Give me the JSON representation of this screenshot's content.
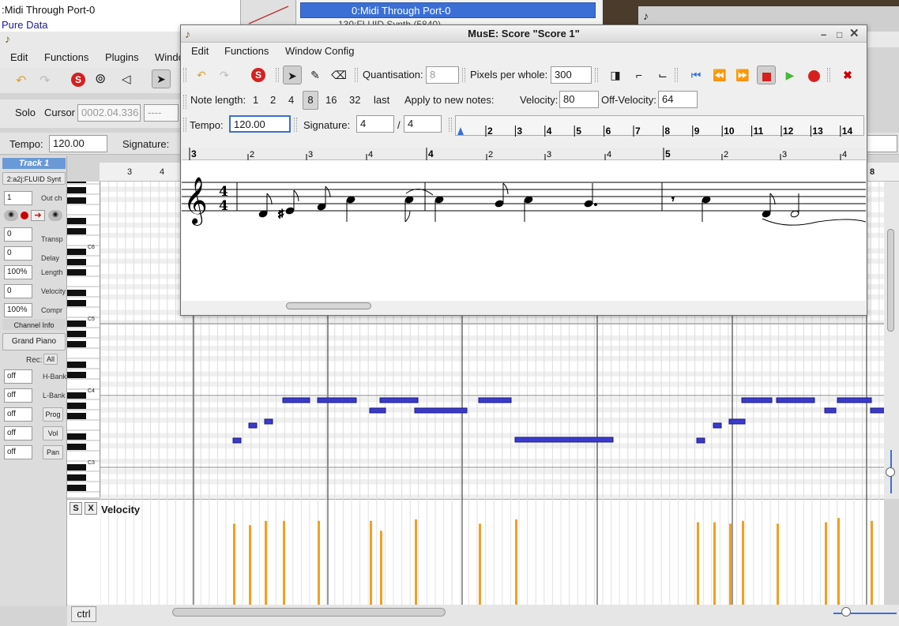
{
  "background": {
    "win1_line1": ":Midi Through Port-0",
    "win1_line2": "Pure Data",
    "win3_selected": "0:Midi Through Port-0",
    "win3_sub": "130:FLUID Synth (5840)"
  },
  "main": {
    "menu": [
      "Edit",
      "Functions",
      "Plugins",
      "Windo"
    ],
    "solo_label": "Solo",
    "cursor_label": "Cursor",
    "cursor_value": "0002.04.336",
    "cursor_extra": "----",
    "tempo_label": "Tempo:",
    "tempo_value": "120.00",
    "signature_label": "Signature:"
  },
  "track_panel": {
    "title": "Track 1",
    "port": "2:a2j:FLUID Synt",
    "out_ch_value": "1",
    "out_ch_label": "Out ch",
    "transp_value": "0",
    "transp_label": "Transp",
    "delay_value": "0",
    "delay_label": "Delay",
    "length_value": "100%",
    "length_label": "Length",
    "velocity_value": "0",
    "velocity_label": "Velocity",
    "compr_value": "100%",
    "compr_label": "Compr",
    "channel_info": "Channel Info",
    "instrument": "Grand Piano",
    "rec_label": "Rec:",
    "rec_all": "All",
    "hbank_value": "off",
    "hbank_label": "H-Bank",
    "lbank_value": "off",
    "lbank_label": "L-Bank",
    "prog_value": "off",
    "prog_label": "Prog",
    "vol_value": "off",
    "vol_label": "Vol",
    "pan_value": "off",
    "pan_label": "Pan"
  },
  "pianoroll": {
    "ruler_labels": [
      "3",
      "4",
      "8"
    ],
    "octave_labels": [
      "C6",
      "C5",
      "C4",
      "C3"
    ],
    "velocity_s": "S",
    "velocity_x": "X",
    "velocity_label": "Velocity",
    "ctrl_button": "ctrl"
  },
  "score": {
    "title": "MusE: Score \"Score 1\"",
    "menu": [
      "Edit",
      "Functions",
      "Window Config"
    ],
    "quantisation_label": "Quantisation:",
    "quantisation_value": "8",
    "pixels_label": "Pixels per whole:",
    "pixels_value": "300",
    "note_length_label": "Note length:",
    "note_lengths": [
      "1",
      "2",
      "4",
      "8",
      "16",
      "32",
      "last"
    ],
    "note_length_selected": "8",
    "apply_label": "Apply to new notes:",
    "velocity_label": "Velocity:",
    "velocity_value": "80",
    "offvelocity_label": "Off-Velocity:",
    "offvelocity_value": "64",
    "tempo_label": "Tempo:",
    "tempo_value": "120.00",
    "signature_label": "Signature:",
    "sig_num": "4",
    "sig_slash": "/",
    "sig_den": "4",
    "pos_ticks": [
      "2",
      "3",
      "4",
      "5",
      "6",
      "7",
      "8",
      "9",
      "10",
      "11",
      "12",
      "13",
      "14"
    ],
    "staff_ruler": [
      "3",
      "2",
      "3",
      "4",
      "4",
      "2",
      "3",
      "4",
      "5",
      "2",
      "3",
      "4"
    ],
    "time_sig_top": "4",
    "time_sig_bottom": "4"
  },
  "colors": {
    "note": "#3a3acb",
    "velocity_bar": "#f0a020",
    "track_header": "#6a99d8",
    "selection": "#3b6fd6"
  }
}
